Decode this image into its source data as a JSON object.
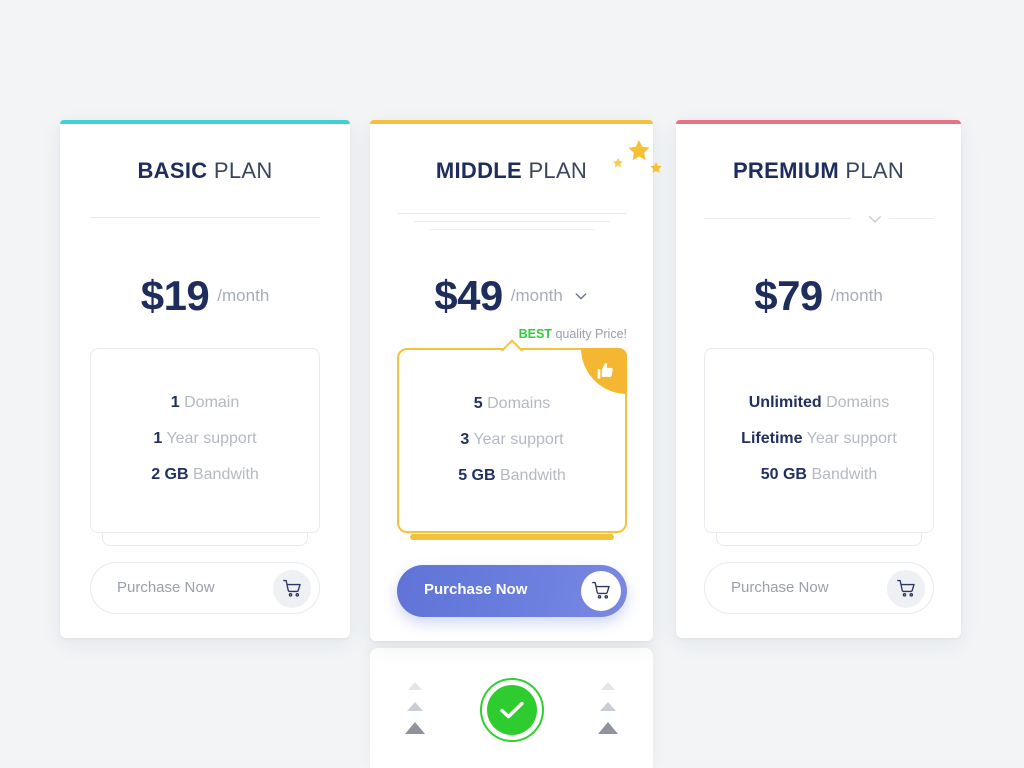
{
  "page": {
    "background_color": "#f2f4f6"
  },
  "plans": [
    {
      "id": "basic",
      "title_strong": "BASIC",
      "title_light": "PLAN",
      "accent_color": "#3ed2d6",
      "price": "$19",
      "period": "/month",
      "features": [
        {
          "value": "1",
          "label": "Domain"
        },
        {
          "value": "1",
          "label": "Year support"
        },
        {
          "value": "2 GB",
          "label": "Bandwith"
        }
      ],
      "cta_label": "Purchase Now",
      "cart_icon": "shopping-cart-icon"
    },
    {
      "id": "middle",
      "title_strong": "MIDDLE",
      "title_light": "PLAN",
      "accent_color": "#f3c13e",
      "price": "$49",
      "period": "/month",
      "price_chevron_icon": "chevron-down-icon",
      "tag_strong": "BEST",
      "tag_rest": "quality Price!",
      "tag_strong_color": "#31cc39",
      "badge_icon": "thumbs-up-icon",
      "stars_icon": "sparkle-stars-icon",
      "features": [
        {
          "value": "5",
          "label": "Domains"
        },
        {
          "value": "3",
          "label": "Year support"
        },
        {
          "value": "5 GB",
          "label": "Bandwith"
        }
      ],
      "cta_label": "Purchase Now",
      "cart_icon": "shopping-cart-icon",
      "cta_gradient_from": "#5f74d6",
      "cta_gradient_to": "#7a88e2"
    },
    {
      "id": "premium",
      "title_strong": "PREMIUM",
      "title_light": "PLAN",
      "accent_color": "#ea7280",
      "price": "$79",
      "period": "/month",
      "divider_chevron_icon": "chevron-down-icon",
      "features": [
        {
          "value": "Unlimited",
          "label": "Domains"
        },
        {
          "value": "Lifetime",
          "label": "Year support"
        },
        {
          "value": "50 GB",
          "label": "Bandwith"
        }
      ],
      "cta_label": "Purchase Now",
      "cart_icon": "shopping-cart-icon"
    }
  ],
  "bottom_panel": {
    "status_icon": "green-check-circle-icon",
    "status_color": "#2ecc2e",
    "left_arrows_icon": "triangle-up-icon",
    "right_arrows_icon": "triangle-up-icon"
  }
}
